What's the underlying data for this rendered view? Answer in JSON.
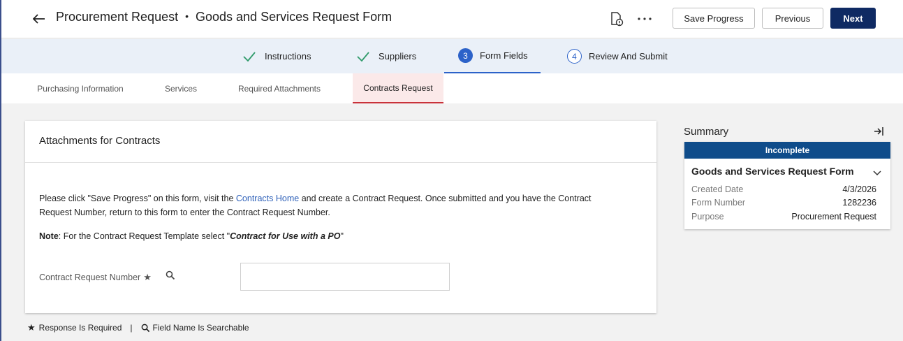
{
  "header": {
    "title": "Procurement Request",
    "subtitle": "Goods and Services Request Form",
    "separator": "•",
    "buttons": {
      "save": "Save Progress",
      "previous": "Previous",
      "next": "Next"
    },
    "icons": [
      "back-arrow-icon",
      "document-info-icon",
      "more-dots-icon"
    ]
  },
  "stepper": {
    "steps": [
      {
        "label": "Instructions",
        "state": "complete"
      },
      {
        "label": "Suppliers",
        "state": "complete"
      },
      {
        "number": "3",
        "label": "Form Fields",
        "state": "active"
      },
      {
        "number": "4",
        "label": "Review And Submit",
        "state": "todo"
      }
    ]
  },
  "subtabs": [
    {
      "label": "Purchasing Information",
      "active": false
    },
    {
      "label": "Services",
      "active": false
    },
    {
      "label": "Required Attachments",
      "active": false
    },
    {
      "label": "Contracts Request",
      "active": true
    }
  ],
  "card": {
    "title": "Attachments for Contracts",
    "para_before": "Please click \"Save Progress\" on this form, visit the ",
    "link": "Contracts Home",
    "para_after": " and create a Contract Request. Once submitted and you have the Contract Request Number, return to this form to enter the Contract Request Number.",
    "note_label": "Note",
    "note_text": ": For the Contract Request Template select \"",
    "note_emph": "Contract for Use with a PO",
    "note_end": "\"",
    "field_label": "Contract Request Number",
    "field_value": ""
  },
  "legend": {
    "required": "Response Is Required",
    "separator": "|",
    "searchable": "Field Name Is Searchable"
  },
  "summary": {
    "title": "Summary",
    "status": "Incomplete",
    "form_name": "Goods and Services Request Form",
    "rows": [
      {
        "key": "Created Date",
        "value": "4/3/2026"
      },
      {
        "key": "Form Number",
        "value": "1282236"
      },
      {
        "key": "Purpose",
        "value": "Procurement Request"
      }
    ]
  },
  "colors": {
    "primary": "#0f2a63",
    "accent": "#2c62c9",
    "check": "#2e9a6a",
    "badge": "#0f4c8a",
    "active_tab": "#c9323a"
  }
}
